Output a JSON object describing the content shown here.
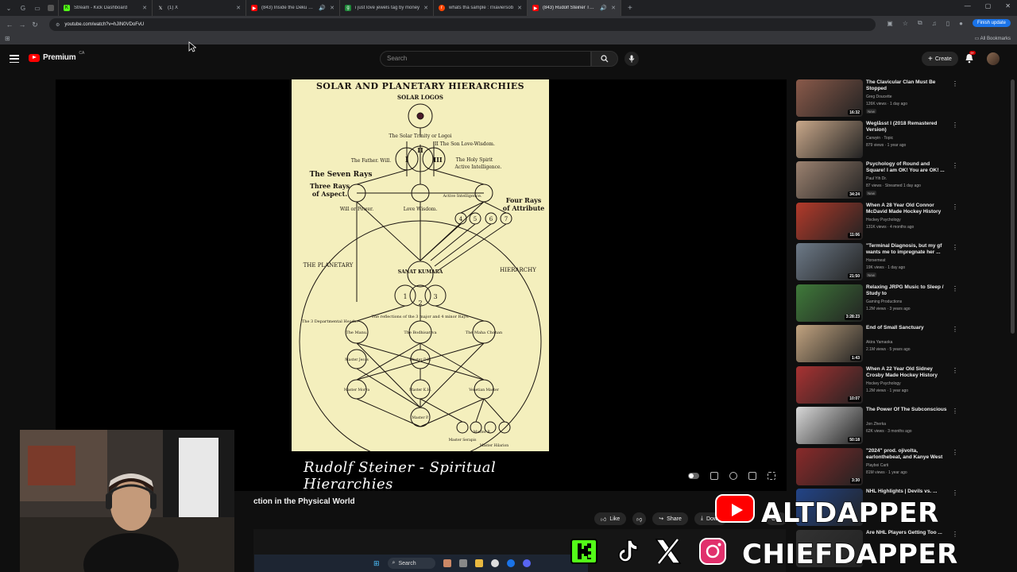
{
  "browser": {
    "tabs": [
      {
        "title": "",
        "active": false
      },
      {
        "title": "Stream - Kick Dashboard",
        "active": false
      },
      {
        "title": "(1) X",
        "active": false
      },
      {
        "title": "(843) Inside the Deku Tree",
        "active": false
      },
      {
        "title": "i just love jewels tag by money",
        "active": false
      },
      {
        "title": "whats tha sample : r/xaviersob",
        "active": false
      },
      {
        "title": "(843) Rudolf Steiner The Sp",
        "active": true
      }
    ],
    "url": "youtube.com/watch?v=hJIN0VDoFvU",
    "finish_update": "Finish update",
    "all_bookmarks": "All Bookmarks"
  },
  "yt": {
    "logo_text": "Premium",
    "region": "CA",
    "search_placeholder": "Search",
    "create_label": "Create",
    "notifications": "9+"
  },
  "slide": {
    "title": "SOLAR AND PLANETARY HIERARCHIES",
    "subtitle": "SOLAR LOGOS",
    "labels": {
      "trinity": "The Solar Trinity or Logoi",
      "son": "II The Son Love-Wisdom.",
      "father": "The Father. Will.",
      "holy_spirit": "The Holy Spirit",
      "active_int": "Active Intelligence.",
      "seven_rays": "The Seven Rays",
      "three_rays": "Three Rays",
      "of_aspect": "of Aspect.",
      "four_rays": "Four Rays",
      "of_attribute": "of Attribute",
      "will_power": "Will or Power.",
      "love_wisdom": "Love Wisdom.",
      "active_intelligence_small": "Active Intelligence.",
      "planetary": "THE PLANETARY",
      "hierarchy": "HIERARCHY",
      "sanat": "SANAT KUMARA",
      "reflections": "The reflections of the 3 major and 4 minor Rays.",
      "three_dept": "The 3 Departmental Heads.",
      "manu": "The Manu.",
      "bodhisattva": "The Bodhisattva",
      "maha": "The Maha Chohan",
      "master_rc": "Master R.",
      "master_dk": "Master D.K.",
      "master_jesus": "Master Jesus",
      "master_morya": "Master Morya",
      "master_kh": "Master K.H.",
      "master_venetian": "Venetian Master",
      "master_ps": "Master P.",
      "master_hilarion": "Master Hilarion",
      "serapis": "Master Serapis",
      "num_I": "I",
      "num_II": "II",
      "num_III": "III",
      "n4": "4",
      "n5": "5",
      "n6": "6",
      "n7": "7",
      "num_1": "1",
      "num_2": "2",
      "num_3": "3"
    }
  },
  "caption": "Rudolf Steiner - Spiritual Hierarchies",
  "video": {
    "title": "ction in the Physical World",
    "like": "Like",
    "share": "Share",
    "download": "Down",
    "clip": "Clip"
  },
  "recommendations": [
    {
      "title": "The Clavicular Clan Must Be Stopped",
      "channel": "Greg Doucette",
      "meta": "126K views · 1 day ago",
      "badge": "New",
      "duration": "16:32",
      "color": "#8a5a4a"
    },
    {
      "title": "Weglåsst I (2018 Remastered Version)",
      "channel": "Carwyin · Topic",
      "meta": "879 views · 1 year ago",
      "badge": "",
      "duration": "",
      "color": "#c9a88a"
    },
    {
      "title": "Psychology of Round and Square! I am OK! You are OK! ...",
      "channel": "Paul Yih Dr.",
      "meta": "87 views · Streamed 1 day ago",
      "badge": "New",
      "duration": "34:24",
      "color": "#9c8270"
    },
    {
      "title": "When A 28 Year Old Connor McDavid Made Hockey History",
      "channel": "Hockey Psychology",
      "meta": "131K views · 4 months ago",
      "badge": "",
      "duration": "11:06",
      "color": "#b33a2a"
    },
    {
      "title": "\"Terminal Diagnosis, but my gf wants me to impregnate her ...",
      "channel": "Horsemeat",
      "meta": "19K views · 1 day ago",
      "badge": "New",
      "duration": "21:50",
      "color": "#6d7a88"
    },
    {
      "title": "Relaxing JRPG Music to Sleep / Study to",
      "channel": "Gaming Productions",
      "meta": "1.2M views · 3 years ago",
      "badge": "",
      "duration": "3:28:23",
      "color": "#3f7a3a"
    },
    {
      "title": "End of Small Sanctuary",
      "channel": "Akira Yamaoka",
      "meta": "2.1M views · 5 years ago",
      "badge": "",
      "duration": "1:43",
      "color": "#c2a480"
    },
    {
      "title": "When A 22 Year Old Sidney Crosby Made Hockey History",
      "channel": "Hockey Psychology",
      "meta": "1.2M views · 1 year ago",
      "badge": "",
      "duration": "10:07",
      "color": "#a83232"
    },
    {
      "title": "The Power Of The Subconscious",
      "channel": "Jon Zherka",
      "meta": "62K views · 3 months ago",
      "badge": "",
      "duration": "50:18",
      "color": "#d8d8d8"
    },
    {
      "title": "\"2024\" prod. ojivolta, earlonthebeat, and Kanye West",
      "channel": "Playboi Carti",
      "meta": "81M views · 1 year ago",
      "badge": "",
      "duration": "3:30",
      "color": "#8a2a2a"
    },
    {
      "title": "NHL Highlights | Devils vs. ...",
      "channel": "",
      "meta": "",
      "badge": "",
      "duration": "",
      "color": "#224488"
    },
    {
      "title": "Are NHL Players Getting Too ...",
      "channel": "",
      "meta": "",
      "badge": "",
      "duration": "",
      "color": "#333333"
    }
  ],
  "overlay": {
    "line1": "ALTDAPPER",
    "line2": "CHIEFDAPPER",
    "socials": [
      "kick-icon",
      "tiktok-icon",
      "x-icon",
      "instagram-icon"
    ]
  },
  "taskbar": {
    "search": "Search"
  }
}
